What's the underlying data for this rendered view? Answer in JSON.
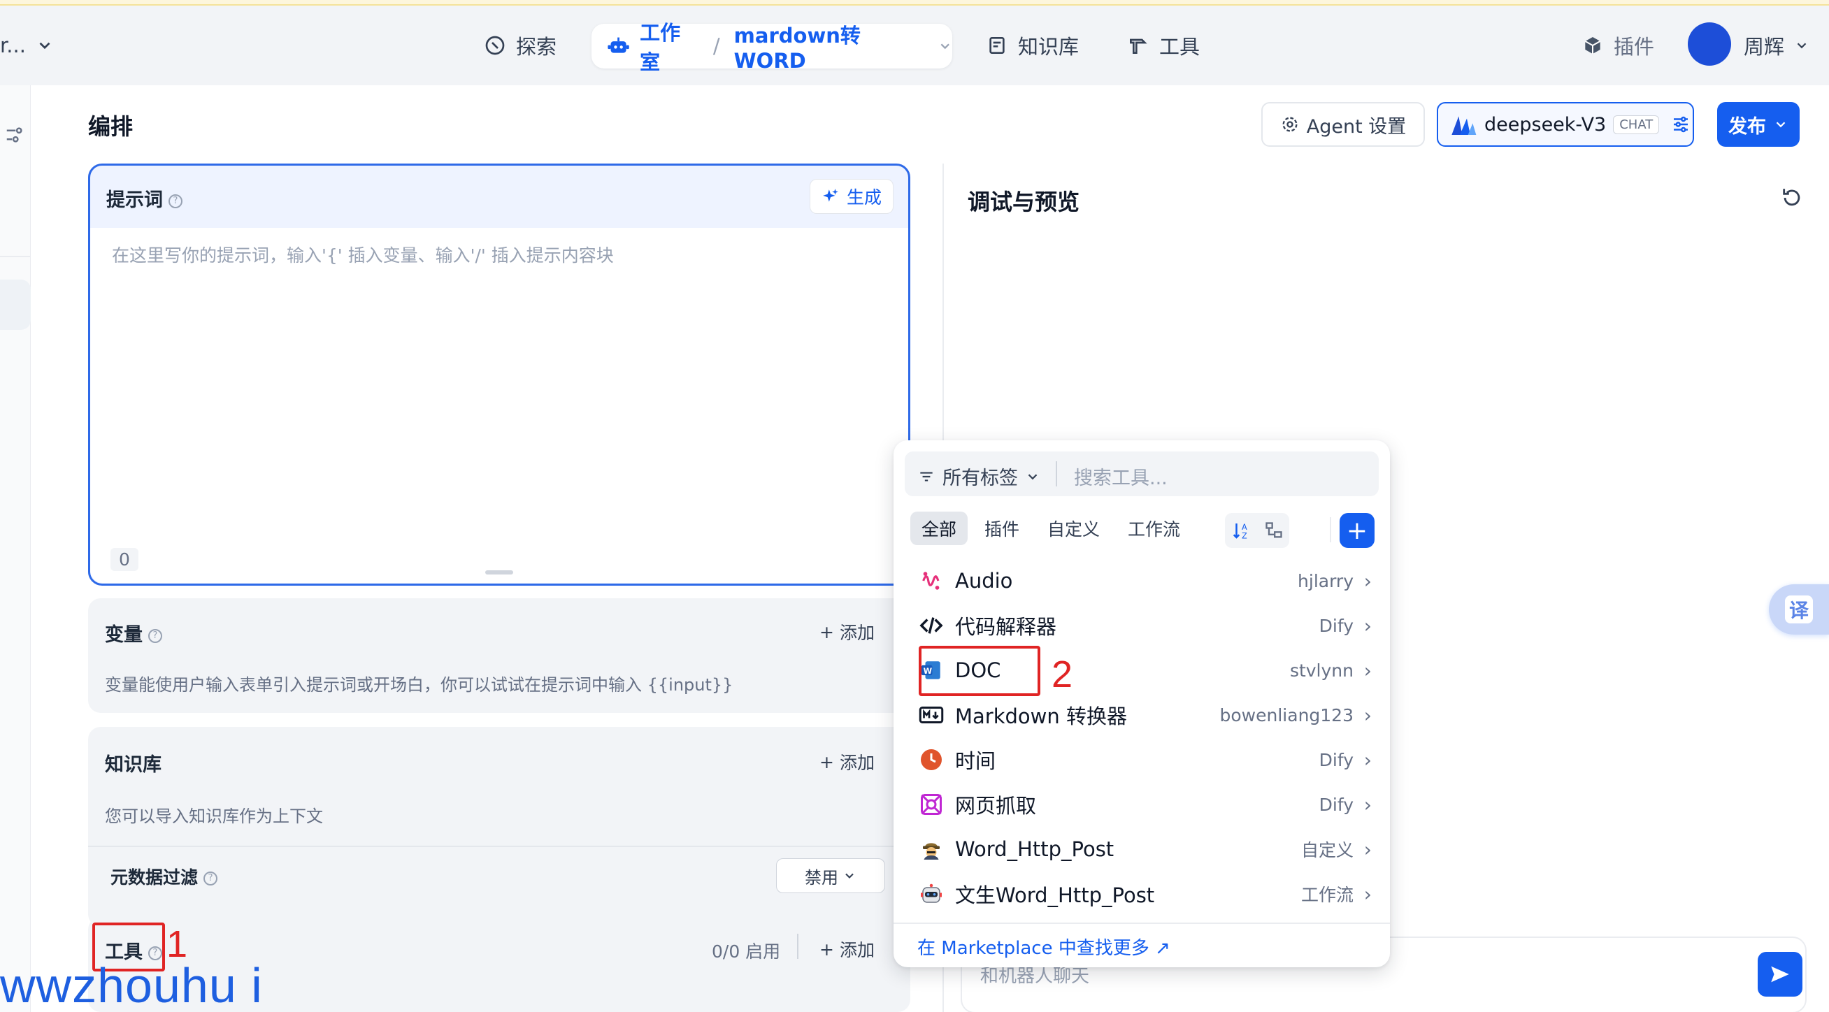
{
  "nav": {
    "left_truncated": "r...",
    "explore": "探索",
    "studio": "工作室",
    "app_name": "mardown转WORD",
    "knowledge": "知识库",
    "tools": "工具",
    "plugins": "插件",
    "user": "周辉"
  },
  "header": {
    "title": "编排",
    "agent_settings": "Agent 设置",
    "model": "deepseek-V3",
    "model_badge": "CHAT",
    "publish": "发布"
  },
  "prompt": {
    "title": "提示词",
    "generate": "生成",
    "placeholder": "在这里写你的提示词，输入'{' 插入变量、输入'/' 插入提示内容块",
    "char_count": "0"
  },
  "variables": {
    "title": "变量",
    "add": "添加",
    "desc": "变量能使用户输入表单引入提示词或开场白，你可以试试在提示词中输入 {{input}}"
  },
  "knowledge": {
    "title": "知识库",
    "add": "添加",
    "desc": "您可以导入知识库作为上下文",
    "metadata_filter": "元数据过滤",
    "metadata_value": "禁用"
  },
  "tools": {
    "title": "工具",
    "count": "0/0 启用",
    "add": "添加"
  },
  "preview": {
    "title": "调试与预览",
    "chat_placeholder": "和机器人聊天"
  },
  "translate_btn": "译",
  "popup": {
    "tag_filter": "所有标签",
    "search_placeholder": "搜索工具...",
    "tabs": [
      "全部",
      "插件",
      "自定义",
      "工作流"
    ],
    "items": [
      {
        "name": "Audio",
        "source": "hjlarry",
        "icon": "audio-icon"
      },
      {
        "name": "代码解释器",
        "source": "Dify",
        "icon": "code-icon"
      },
      {
        "name": "DOC",
        "source": "stvlynn",
        "icon": "word-doc-icon"
      },
      {
        "name": "Markdown 转换器",
        "source": "bowenliang123",
        "icon": "markdown-icon"
      },
      {
        "name": "时间",
        "source": "Dify",
        "icon": "clock-icon"
      },
      {
        "name": "网页抓取",
        "source": "Dify",
        "icon": "web-scraper-icon"
      },
      {
        "name": "Word_Http_Post",
        "source": "自定义",
        "icon": "custom-tool-icon"
      },
      {
        "name": "文生Word_Http_Post",
        "source": "工作流",
        "icon": "workflow-robot-icon"
      }
    ],
    "marketplace": "在 Marketplace 中查找更多 ↗"
  },
  "annotations": {
    "label1": "1",
    "label2": "2"
  },
  "watermark": "wwzhouhu i",
  "colors": {
    "accent": "#155eef",
    "annotation": "#e02424"
  }
}
